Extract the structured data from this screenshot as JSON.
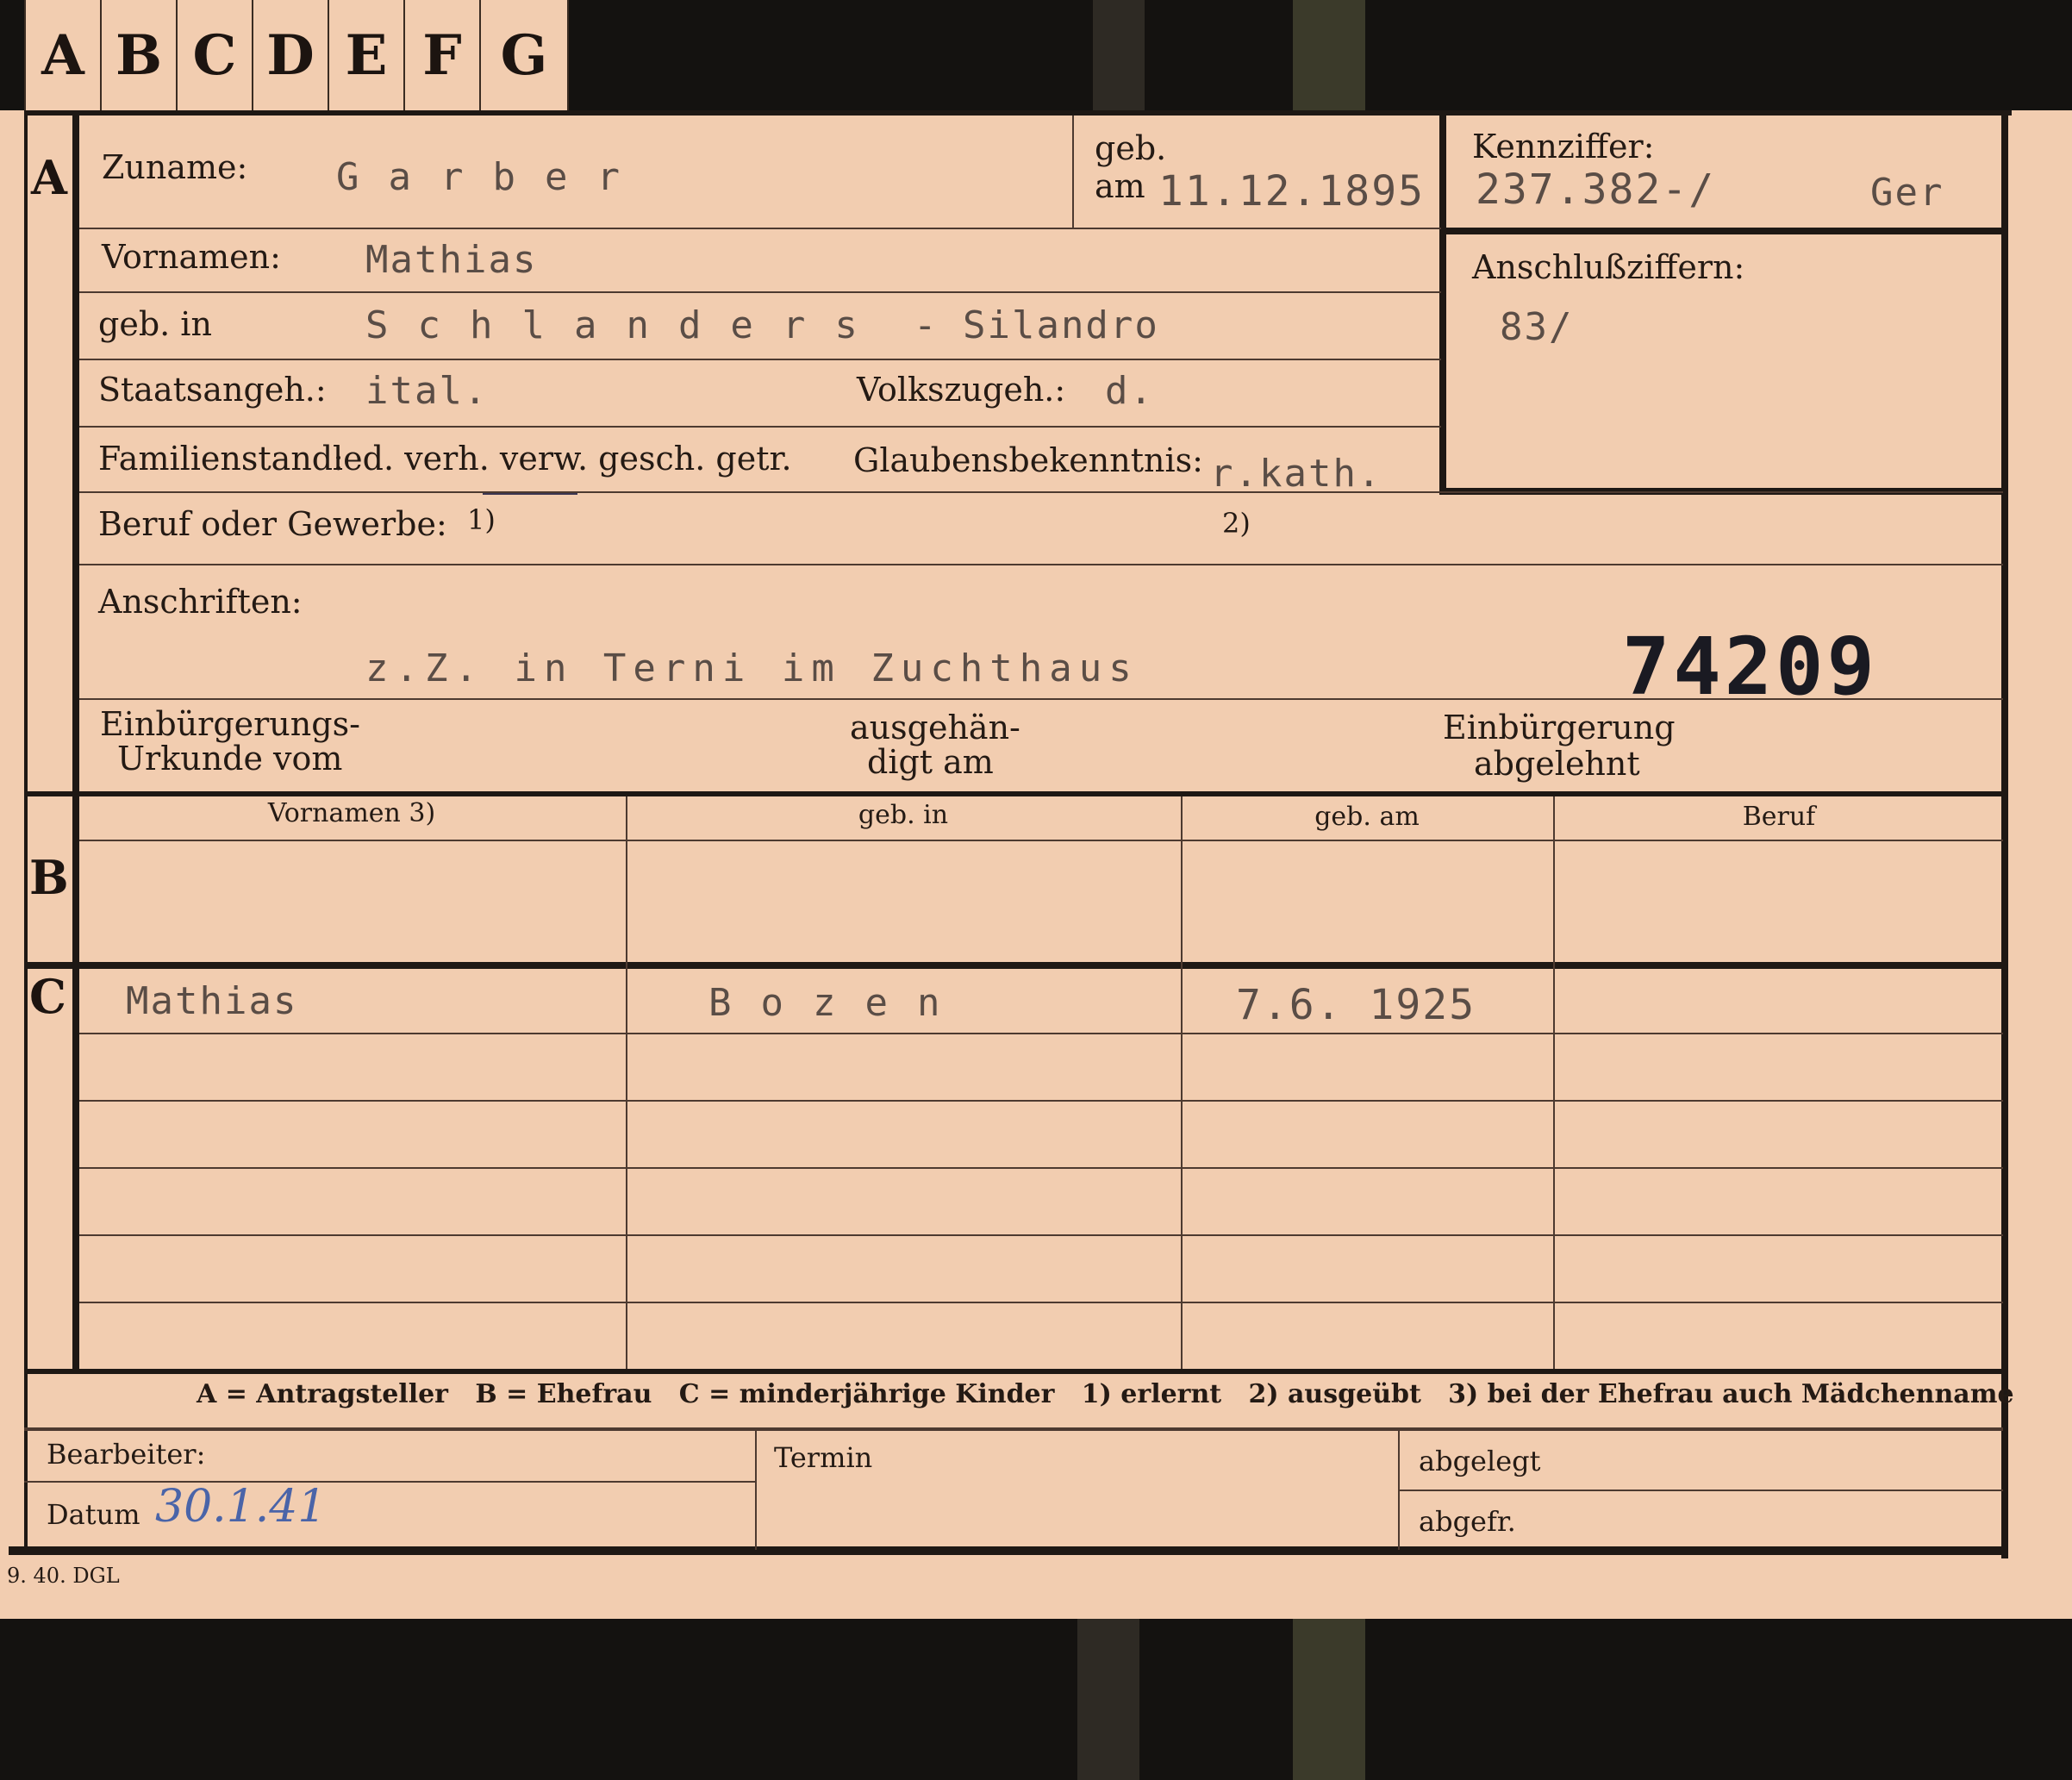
{
  "tabs": [
    "A",
    "B",
    "C",
    "D",
    "E",
    "F",
    "G"
  ],
  "section_a": {
    "marker": "A",
    "zuname_label": "Zuname:",
    "zuname_value": "Garber",
    "geb_label": "geb.",
    "am_label": "am",
    "geb_am_value": "11.12.1895",
    "kennziffer_label": "Kennziffer:",
    "kennziffer_value": "237.382-/",
    "kennziffer_suffix": "Ger",
    "anschluss_label": "Anschlußziffern:",
    "anschluss_value": "83/",
    "vornamen_label": "Vornamen:",
    "vornamen_value": "Mathias",
    "geb_in_label": "geb. in",
    "geb_in_value": "Schlanders",
    "geb_in_value_it": "- Silandro",
    "staatsangeh_label": "Staatsangeh.:",
    "staatsangeh_value": "ital.",
    "volkszugeh_label": "Volkszugeh.:",
    "volkszugeh_value": "d.",
    "familienstand_label": "Familienstand:",
    "familienstand_options": "led. verh. verw. gesch. getr.",
    "glaubens_label": "Glaubensbekenntnis:",
    "glaubens_value": "r.kath.",
    "beruf_label": "Beruf oder Gewerbe:",
    "beruf_note1": "1)",
    "beruf_note2": "2)",
    "anschriften_label": "Anschriften:",
    "anschriften_value": "z.Z. in Terni im Zuchthaus",
    "stamp_number": "74209",
    "einbuerg_urkunde_line1": "Einbürgerungs-",
    "einbuerg_urkunde_line2": "Urkunde vom",
    "ausgehaendigt_line1": "ausgehän-",
    "ausgehaendigt_line2": "digt am",
    "abgelehnt_line1": "Einbürgerung",
    "abgelehnt_line2": "abgelehnt"
  },
  "section_b": {
    "marker": "B",
    "headers": [
      "Vornamen 3)",
      "geb. in",
      "geb. am",
      "Beruf"
    ]
  },
  "section_c": {
    "marker": "C",
    "rows": [
      {
        "vorname": "Mathias",
        "geb_in": "Bozen",
        "geb_am": "7.6. 1925",
        "beruf": ""
      }
    ]
  },
  "legend": "A = Antragsteller   B = Ehefrau   C = minderjährige Kinder   1) erlernt   2) ausgeübt   3) bei der Ehefrau auch Mädchenname",
  "footer": {
    "bearbeiter_label": "Bearbeiter:",
    "datum_label": "Datum",
    "datum_value": "30.1.41",
    "termin_label": "Termin",
    "abgelegt_label": "abgelegt",
    "abgefr_label": "abgefr.",
    "print_code": "9. 40. DGL"
  },
  "colors": {
    "card": "#f2cdb0",
    "ink": "#241a14",
    "typewriter": "#5a4d46",
    "handwriting": "#4a64a8",
    "background": "#141210"
  }
}
